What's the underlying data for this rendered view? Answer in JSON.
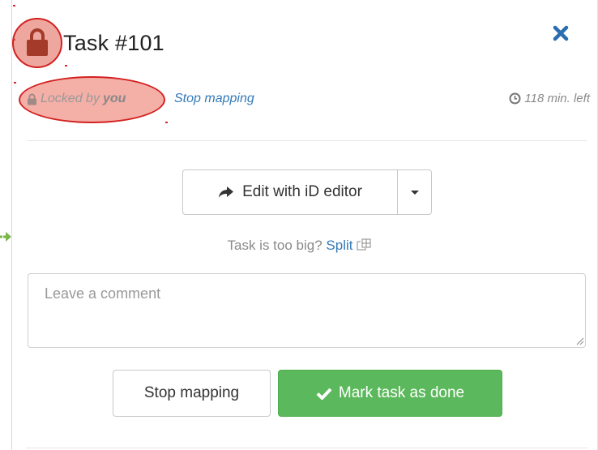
{
  "task": {
    "title": "Task #101"
  },
  "lock": {
    "locked_by_prefix": "Locked by",
    "locked_by_user": "you",
    "stop_link": "Stop mapping",
    "time_left": "118 min. left"
  },
  "editor": {
    "edit_label": "Edit with iD editor"
  },
  "split": {
    "question": "Task is too big?",
    "link": "Split"
  },
  "comment": {
    "placeholder": "Leave a comment"
  },
  "actions": {
    "stop_label": "Stop mapping",
    "done_label": "Mark task as done"
  },
  "colors": {
    "link": "#337ab7",
    "success": "#5cb85c",
    "lock_icon": "#a33a2a",
    "highlight_border": "#d32020"
  },
  "icons": {
    "lock": "lock-icon",
    "close": "close-icon",
    "clock": "clock-icon",
    "share": "share-arrow-icon",
    "caret": "caret-down-icon",
    "split": "split-icon",
    "check": "check-icon"
  }
}
